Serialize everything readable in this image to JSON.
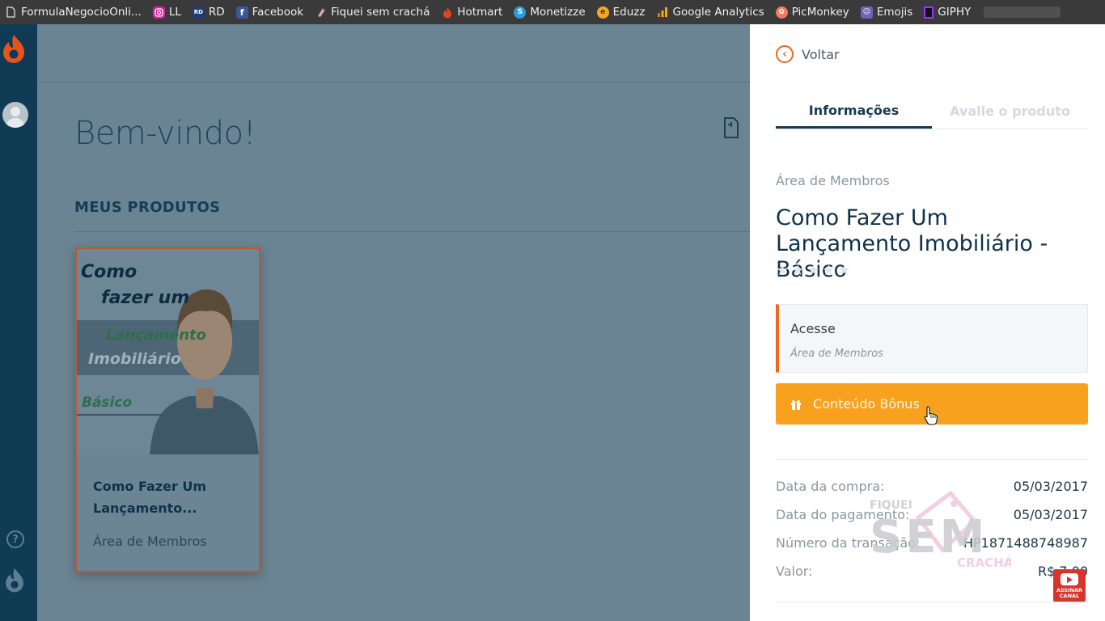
{
  "bookmarks": [
    {
      "label": "FormulaNegocioOnli...",
      "icon": "page-icon",
      "color": "#cccccc"
    },
    {
      "label": "LL",
      "icon": "instagram-icon",
      "color": "#d6249f"
    },
    {
      "label": "RD",
      "icon": "rd-icon",
      "color": "#1f3b73"
    },
    {
      "label": "Facebook",
      "icon": "facebook-icon",
      "color": "#3b5998"
    },
    {
      "label": "Fiquei sem crachá",
      "icon": "badge-icon",
      "color": "#e7a0c8"
    },
    {
      "label": "Hotmart",
      "icon": "flame-icon",
      "color": "#e8421c"
    },
    {
      "label": "Monetizze",
      "icon": "monetizze-icon",
      "color": "#2d9cdb"
    },
    {
      "label": "Eduzz",
      "icon": "eduzz-icon",
      "color": "#f5a623"
    },
    {
      "label": "Google Analytics",
      "icon": "analytics-icon",
      "color": "#f29900"
    },
    {
      "label": "PicMonkey",
      "icon": "picmonkey-icon",
      "color": "#f47a5b"
    },
    {
      "label": "Emojis",
      "icon": "emojis-icon",
      "color": "#6f62b8"
    },
    {
      "label": "GIPHY",
      "icon": "giphy-icon",
      "color": "#9933ff"
    }
  ],
  "rail": {
    "logo_icon": "hotmart-flame-icon",
    "avatar": "user-avatar",
    "help_label": "?",
    "logo_bottom_icon": "hotmart-flame-icon"
  },
  "main": {
    "welcome": "Bem-vindo!",
    "section_title": "MEUS PRODUTOS",
    "card": {
      "cover_line1": "Como",
      "cover_line2": "fazer um",
      "cover_line3": "Lançamento",
      "cover_line4": "Imobiliário",
      "cover_line5": "Básico",
      "title": "Como Fazer Um Lançamento...",
      "subtitle": "Área de Membros"
    }
  },
  "panel": {
    "back_label": "Voltar",
    "tabs": [
      {
        "label": "Informações",
        "active": true
      },
      {
        "label": "Avalie o produto",
        "active": false
      }
    ],
    "area_label": "Área de Membros",
    "product_title": "Como Fazer Um Lançamento Imobiliário - Básico",
    "rating": {
      "value": 0,
      "max": 5
    },
    "access": {
      "title": "Acesse",
      "subtitle": "Área de Membros"
    },
    "bonus_label": "Conteúdo Bônus",
    "details": [
      {
        "label": "Data da compra:",
        "value": "05/03/2017"
      },
      {
        "label": "Data do pagamento:",
        "value": "05/03/2017"
      },
      {
        "label": "Número da transação:",
        "value": "HP1871488748987"
      },
      {
        "label": "Valor:",
        "value": "R$ 7,00"
      }
    ]
  },
  "watermark": {
    "top": "FIQUEI",
    "middle": "SEM",
    "bottom": "CRACHÁ"
  },
  "youtube_badge": {
    "line1": "ASSINAR",
    "line2": "CANAL"
  },
  "colors": {
    "accent_orange": "#e96a1c",
    "bonus_yellow": "#f8a11e",
    "dark_blue": "#0f3b55"
  }
}
